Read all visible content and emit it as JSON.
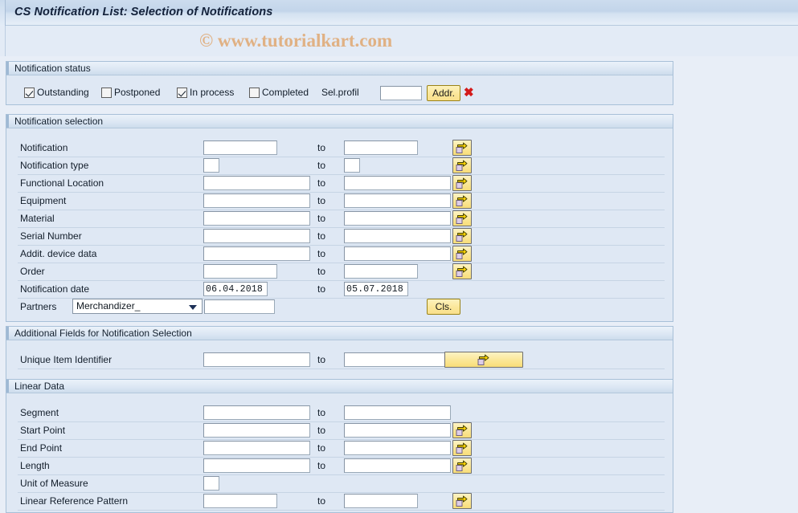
{
  "window": {
    "title": "CS Notification List: Selection of Notifications",
    "watermark": "© www.tutorialkart.com"
  },
  "status_section": {
    "header": "Notification status",
    "checkboxes": [
      {
        "label": "Outstanding",
        "checked": true
      },
      {
        "label": "Postponed",
        "checked": false
      },
      {
        "label": "In process",
        "checked": true
      },
      {
        "label": "Completed",
        "checked": false
      }
    ],
    "sel_profil_label": "Sel.profil",
    "sel_profil_value": "",
    "addr_button": "Addr.",
    "delete_icon": "✖"
  },
  "notification_selection": {
    "header": "Notification selection",
    "to_label": "to",
    "rows": [
      {
        "label": "Notification",
        "from": "",
        "to": "",
        "size": "short",
        "arrow": true
      },
      {
        "label": "Notification type",
        "from": "",
        "to": "",
        "size": "tiny",
        "arrow": true
      },
      {
        "label": "Functional Location",
        "from": "",
        "to": "",
        "size": "long",
        "arrow": true
      },
      {
        "label": "Equipment",
        "from": "",
        "to": "",
        "size": "long",
        "arrow": true
      },
      {
        "label": "Material",
        "from": "",
        "to": "",
        "size": "long",
        "arrow": true
      },
      {
        "label": "Serial Number",
        "from": "",
        "to": "",
        "size": "long",
        "arrow": true
      },
      {
        "label": "Addit. device data",
        "from": "",
        "to": "",
        "size": "long",
        "arrow": true
      },
      {
        "label": "Order",
        "from": "",
        "to": "",
        "size": "short",
        "arrow": true
      }
    ],
    "date_row": {
      "label": "Notification date",
      "from": "06.04.2018",
      "to": "05.07.2018",
      "to_label": "to"
    },
    "partners_row": {
      "label": "Partners",
      "selected": "Merchandizer_",
      "value": "",
      "button": "Cls."
    }
  },
  "additional_fields": {
    "header": "Additional Fields for Notification Selection",
    "to_label": "to",
    "rows": [
      {
        "label": "Unique Item Identifier",
        "from": "",
        "to": "",
        "size": "long",
        "arrow": "wide"
      }
    ]
  },
  "linear_data": {
    "header": "Linear Data",
    "to_label": "to",
    "rows": [
      {
        "label": "Segment",
        "from": "",
        "to": "",
        "size": "long",
        "arrow": false
      },
      {
        "label": "Start Point",
        "from": "",
        "to": "",
        "size": "long",
        "arrow": true
      },
      {
        "label": "End Point",
        "from": "",
        "to": "",
        "size": "long",
        "arrow": true
      },
      {
        "label": "Length",
        "from": "",
        "to": "",
        "size": "long",
        "arrow": true
      },
      {
        "label": "Unit of Measure",
        "from": "",
        "to": null,
        "size": "tiny",
        "arrow": false
      },
      {
        "label": "Linear Reference Pattern",
        "from": "",
        "to": "",
        "size": "short",
        "arrow": true
      }
    ]
  },
  "icons": {
    "arrow_select": "multi-select-arrow-icon",
    "dropdown": "chevron-down-icon",
    "delete": "delete-x-icon"
  },
  "colors": {
    "page_bg": "#e8eef7",
    "group_bg": "#dfe8f4",
    "accent_button": "#fbe89a",
    "delete_red": "#d31a1a",
    "watermark": "#e0b184"
  }
}
